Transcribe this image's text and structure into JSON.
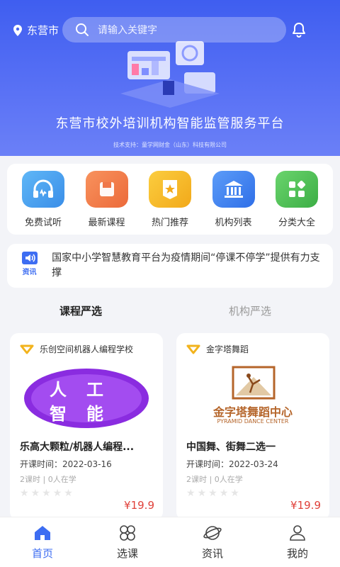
{
  "header": {
    "city": "东营市",
    "search_placeholder": "请输入关键字",
    "platform_title": "东营市校外培训机构智能监管服务平台",
    "tech_support": "技术支持：童学网财金（山东）科技有限公司"
  },
  "quick_menu": [
    {
      "label": "免费试听",
      "icon": "headphones-icon",
      "color": "#4aa3f2"
    },
    {
      "label": "最新课程",
      "icon": "new-course-icon",
      "color": "#f0784a"
    },
    {
      "label": "热门推荐",
      "icon": "star-badge-icon",
      "color": "#f5b928"
    },
    {
      "label": "机构列表",
      "icon": "institution-icon",
      "color": "#3d86f2"
    },
    {
      "label": "分类大全",
      "icon": "category-grid-icon",
      "color": "#52c45a"
    }
  ],
  "notice": {
    "tag": "资讯",
    "text": "国家中小学智慧教育平台为疫情期间“停课不停学”提供有力支撑"
  },
  "tabs": {
    "active": "课程严选",
    "inactive": "机构严选"
  },
  "courses": [
    {
      "org": "乐创空间机器人编程学校",
      "thumb_text_1": "人工",
      "thumb_text_2": "智能",
      "title": "乐高大颗粒/机器人编程...",
      "date": "开课时间：2022-03-16",
      "meta": "2课时 | 0人在学",
      "price": "¥19.9"
    },
    {
      "org": "金字塔舞蹈",
      "thumb_text_1": "金字塔舞蹈中心",
      "thumb_text_2": "PYRAMID DANCE CENTER",
      "title": "中国舞、街舞二选一",
      "date": "开课时间：2022-03-24",
      "meta": "2课时 | 0人在学",
      "price": "¥19.9"
    }
  ],
  "bottom_nav": [
    {
      "label": "首页",
      "icon": "home-icon",
      "active": true
    },
    {
      "label": "选课",
      "icon": "select-course-icon",
      "active": false
    },
    {
      "label": "资讯",
      "icon": "news-icon",
      "active": false
    },
    {
      "label": "我的",
      "icon": "profile-icon",
      "active": false
    }
  ],
  "colors": {
    "accent": "#3d6df2",
    "price": "#e0413a",
    "hero_top": "#3f5ef0"
  }
}
